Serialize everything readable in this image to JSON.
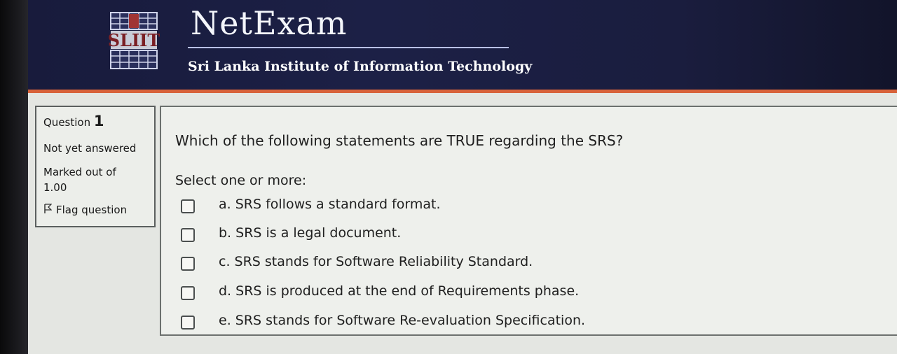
{
  "header": {
    "logo_text": "SLIIT",
    "title": "NetExam",
    "subtitle": "Sri Lanka Institute of Information Technology"
  },
  "question_info": {
    "label": "Question",
    "number": "1",
    "status": "Not yet answered",
    "marked_label": "Marked out of",
    "marked_value": "1.00",
    "flag_label": "Flag question"
  },
  "question": {
    "text": "Which of the following statements are TRUE regarding the SRS?",
    "instruction": "Select one or more:",
    "options": [
      {
        "label": "a. SRS follows a standard format.",
        "checked": false
      },
      {
        "label": "b. SRS is a legal document.",
        "checked": false
      },
      {
        "label": "c. SRS stands for Software Reliability Standard.",
        "checked": false
      },
      {
        "label": "d. SRS is produced at the end of Requirements phase.",
        "checked": false
      },
      {
        "label": "e. SRS stands for Software Re-evaluation Specification.",
        "checked": false
      }
    ]
  },
  "colors": {
    "header_bg": "#1c2046",
    "accent_band": "#d8623a",
    "content_bg": "#e4e6e2"
  }
}
